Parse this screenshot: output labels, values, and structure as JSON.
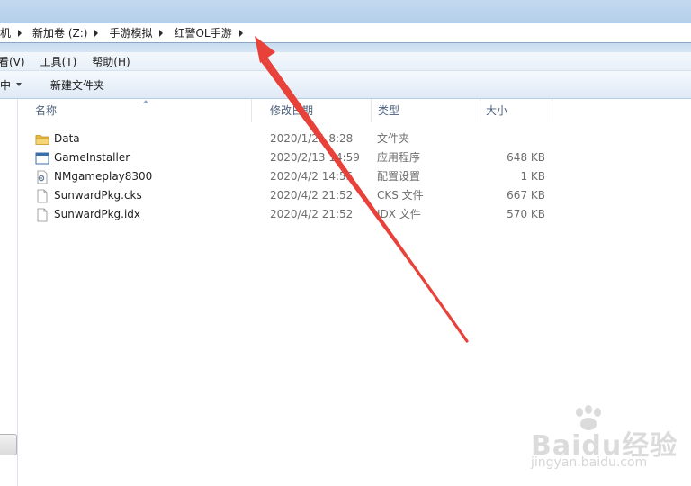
{
  "breadcrumb": {
    "items": [
      {
        "label": "机"
      },
      {
        "label": "新加卷 (Z:)"
      },
      {
        "label": "手游模拟"
      },
      {
        "label": "红警OL手游"
      }
    ]
  },
  "menubar": {
    "items": [
      {
        "label": "看(V)"
      },
      {
        "label": "工具(T)"
      },
      {
        "label": "帮助(H)"
      }
    ]
  },
  "toolbar": {
    "include_label": "中",
    "new_folder_label": "新建文件夹"
  },
  "columns": {
    "name": "名称",
    "date": "修改日期",
    "type": "类型",
    "size": "大小"
  },
  "files": [
    {
      "name": "Data",
      "date": "2020/1/21 8:28",
      "type": "文件夹",
      "size": "",
      "icon": "folder-icon"
    },
    {
      "name": "GameInstaller",
      "date": "2020/2/13 14:59",
      "type": "应用程序",
      "size": "648 KB",
      "icon": "application-icon"
    },
    {
      "name": "NMgameplay8300",
      "date": "2020/4/2 14:55",
      "type": "配置设置",
      "size": "1 KB",
      "icon": "config-file-icon"
    },
    {
      "name": "SunwardPkg.cks",
      "date": "2020/4/2 21:52",
      "type": "CKS 文件",
      "size": "667 KB",
      "icon": "document-icon"
    },
    {
      "name": "SunwardPkg.idx",
      "date": "2020/4/2 21:52",
      "type": "IDX 文件",
      "size": "570 KB",
      "icon": "document-icon"
    }
  ],
  "watermark": {
    "brand": "Baidu经验",
    "url": "jingyan.baidu.com"
  },
  "colors": {
    "annotation_arrow": "#e8413a",
    "titlebar": "#c3d9ef"
  }
}
